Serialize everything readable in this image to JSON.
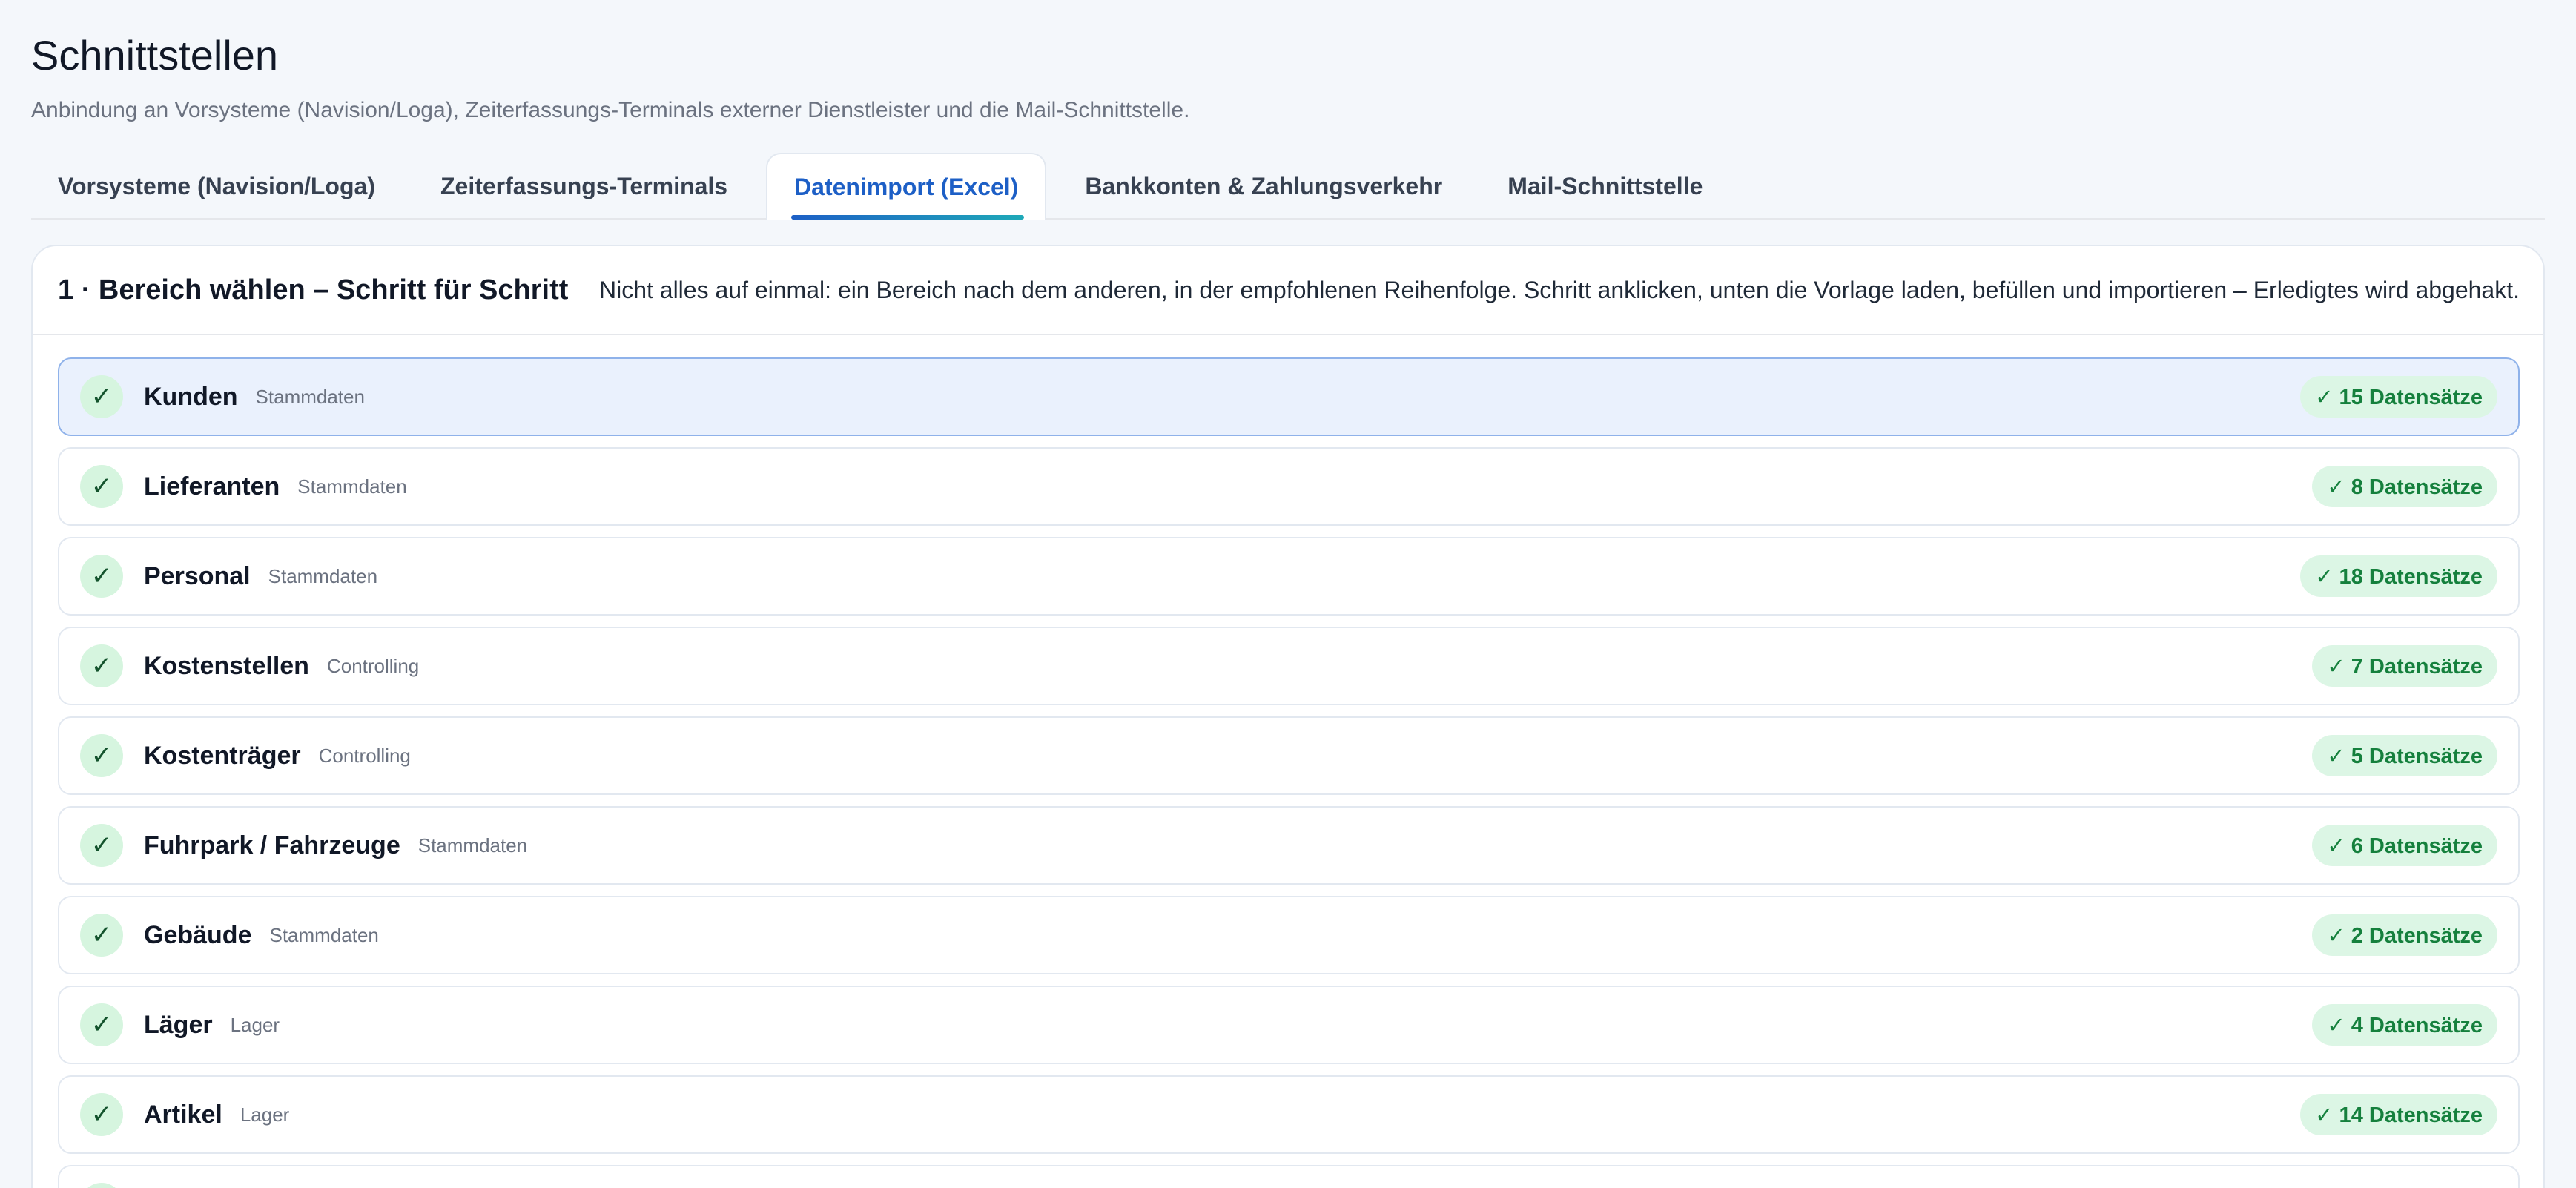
{
  "page": {
    "title": "Schnittstellen",
    "subtitle": "Anbindung an Vorsysteme (Navision/Loga), Zeiterfassungs-Terminals externer Dienstleister und die Mail-Schnittstelle."
  },
  "tabs": [
    {
      "label": "Vorsysteme (Navision/Loga)",
      "active": false
    },
    {
      "label": "Zeiterfassungs-Terminals",
      "active": false
    },
    {
      "label": "Datenimport (Excel)",
      "active": true
    },
    {
      "label": "Bankkonten & Zahlungsverkehr",
      "active": false
    },
    {
      "label": "Mail-Schnittstelle",
      "active": false
    }
  ],
  "card": {
    "title": "1 · Bereich wählen – Schritt für Schritt",
    "hint": "Nicht alles auf einmal: ein Bereich nach dem anderen, in der empfohlenen Reihenfolge. Schritt anklicken, unten die Vorlage laden, befüllen und importieren – Erledigtes wird abgehakt."
  },
  "steps": [
    {
      "check": "✓",
      "name": "Kunden",
      "category": "Stammdaten",
      "badge": "✓ 15 Datensätze",
      "selected": true
    },
    {
      "check": "✓",
      "name": "Lieferanten",
      "category": "Stammdaten",
      "badge": "✓ 8 Datensätze",
      "selected": false
    },
    {
      "check": "✓",
      "name": "Personal",
      "category": "Stammdaten",
      "badge": "✓ 18 Datensätze",
      "selected": false
    },
    {
      "check": "✓",
      "name": "Kostenstellen",
      "category": "Controlling",
      "badge": "✓ 7 Datensätze",
      "selected": false
    },
    {
      "check": "✓",
      "name": "Kostenträger",
      "category": "Controlling",
      "badge": "✓ 5 Datensätze",
      "selected": false
    },
    {
      "check": "✓",
      "name": "Fuhrpark / Fahrzeuge",
      "category": "Stammdaten",
      "badge": "✓ 6 Datensätze",
      "selected": false
    },
    {
      "check": "✓",
      "name": "Gebäude",
      "category": "Stammdaten",
      "badge": "✓ 2 Datensätze",
      "selected": false
    },
    {
      "check": "✓",
      "name": "Läger",
      "category": "Lager",
      "badge": "✓ 4 Datensätze",
      "selected": false
    },
    {
      "check": "✓",
      "name": "Artikel",
      "category": "Lager",
      "badge": "✓ 14 Datensätze",
      "selected": false
    },
    {
      "check": "✓",
      "name": "",
      "category": "",
      "badge": "",
      "selected": false
    }
  ],
  "colors": {
    "accent": "#1d5fc6",
    "success_text": "#15803d",
    "success_bg": "#dcf6e5",
    "selected_bg": "#eaf1fd"
  }
}
